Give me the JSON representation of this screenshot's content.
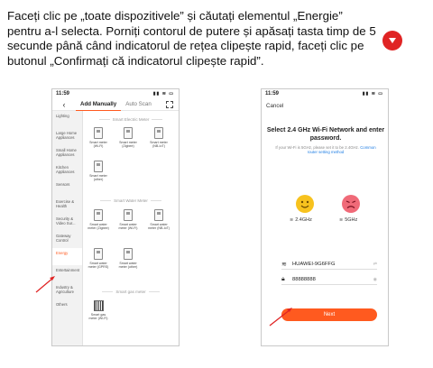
{
  "instruction": {
    "text": "Faceți clic pe „toate dispozitivele” și căutați elementul „Energie” pentru a-l selecta. Porniți contorul de putere și apăsați tasta timp de 5 secunde până când indicatorul de rețea clipește rapid, faceți clic pe butonul „Confirmați că indicatorul clipește rapid”.",
    "badge_icon": "power-button-icon",
    "badge_color": "#e02424"
  },
  "phone1": {
    "time": "11:59",
    "tabs": [
      "Add Manually",
      "Auto Scan"
    ],
    "sidebar": [
      "Lighting",
      "Large Home Appliances",
      "Small Home Appliances",
      "Kitchen Appliances",
      "Sensors",
      "Exercise & Health",
      "Security & Video Sur...",
      "Gateway Control",
      "Energy",
      "Entertainment",
      "Industry & Agriculture",
      "Others"
    ],
    "active_sidebar": "Energy",
    "sections": {
      "electric": "Smart Electric Meter",
      "water": "Smart Water Meter",
      "gas": "Smart gas meter"
    },
    "devices": {
      "electric": [
        "Smart meter (Wi-Fi)",
        "Smart meter (Zigbee)",
        "Smart meter (NB-IoT)",
        "Smart meter (other)"
      ],
      "water": [
        "Smart water meter (Zigbee)",
        "Smart water meter (Wi-Fi)",
        "Smart water meter (NB-IoT)",
        "Smart water meter (GPRS)",
        "Smart water meter (other)"
      ],
      "gas": [
        "Smart gas meter (Wi-Fi)"
      ]
    }
  },
  "phone2": {
    "time": "11:59",
    "cancel": "Cancel",
    "title": "Select 2.4 GHz Wi-Fi Network and enter password.",
    "subtitle": "If your Wi-Fi is 5GHz, please set it to be 2.4GHz.",
    "link": "Common router setting method",
    "band_ok": "2.4GHz",
    "band_bad": "5GHz",
    "ssid": "HUAWEI-9G6FFG",
    "password": "88888888",
    "next_button": "Next",
    "accent": "#ff5a1f"
  }
}
